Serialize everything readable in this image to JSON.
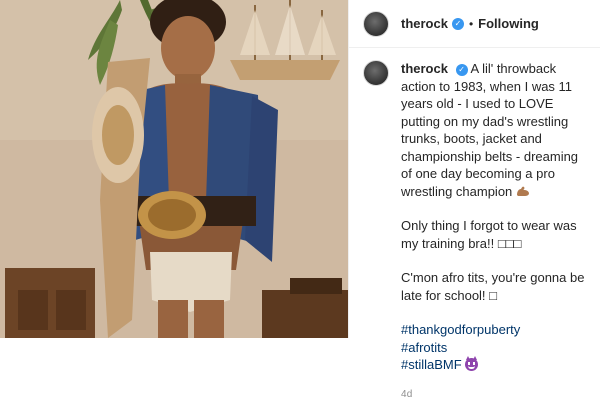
{
  "post": {
    "header": {
      "username": "therock",
      "separator": "•",
      "follow_label": "Following",
      "verified_icon": "verified-badge-icon"
    },
    "caption": {
      "username": "therock",
      "line1": "A lil' throwback action to 1983, when I was 11 years old - I used to LOVE putting on my dad's wrestling trunks, boots, jacket and championship belts - dreaming of one day becoming a pro wrestling champion",
      "line1_emoji": "flexed-biceps-icon",
      "line2": "Only thing I forgot to wear was my training bra!! □□□",
      "line3": "C'mon afro tits, you're gonna be late for school! □",
      "hashtags": [
        "#thankgodforpuberty",
        "#afrotits",
        "#stillaBMF"
      ],
      "last_emoji": "smiling-devil-icon"
    },
    "timestamp": "4d",
    "colors": {
      "link": "#003569",
      "verified": "#3897f0",
      "text": "#262626",
      "muted": "#8e8e8e"
    }
  }
}
